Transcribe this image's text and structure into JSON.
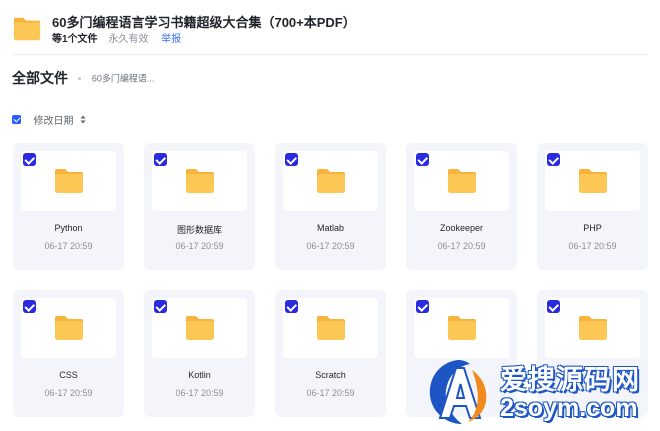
{
  "header": {
    "title": "60多门编程语言学习书籍超级大合集（700+本PDF）",
    "file_count": "等1个文件",
    "validity": "永久有效",
    "report_label": "举报"
  },
  "breadcrumb": {
    "root": "全部文件",
    "current": "60多门编程语..."
  },
  "sort": {
    "label": "修改日期"
  },
  "files": [
    {
      "name": "Python",
      "date": "06-17 20:59"
    },
    {
      "name": "图形数据库",
      "date": "06-17 20:59"
    },
    {
      "name": "Matlab",
      "date": "06-17 20:59"
    },
    {
      "name": "Zookeeper",
      "date": "06-17 20:59"
    },
    {
      "name": "PHP",
      "date": "06-17 20:59"
    },
    {
      "name": "CSS",
      "date": "06-17 20:59"
    },
    {
      "name": "Kotlin",
      "date": "06-17 20:59"
    },
    {
      "name": "Scratch",
      "date": "06-17 20:59"
    },
    {
      "name": "",
      "date": ""
    },
    {
      "name": "",
      "date": ""
    }
  ],
  "watermark": {
    "line1": "爱搜源码网",
    "line2": "2soym.com"
  },
  "colors": {
    "accent": "#2a2ae0",
    "link": "#3a6ff5",
    "folder": "#fbc24e",
    "card_bg": "#f4f5fa"
  },
  "icons": {
    "folder": "folder-icon",
    "checkbox": "checkbox-checked-icon",
    "sort": "sort-caret-icon"
  }
}
